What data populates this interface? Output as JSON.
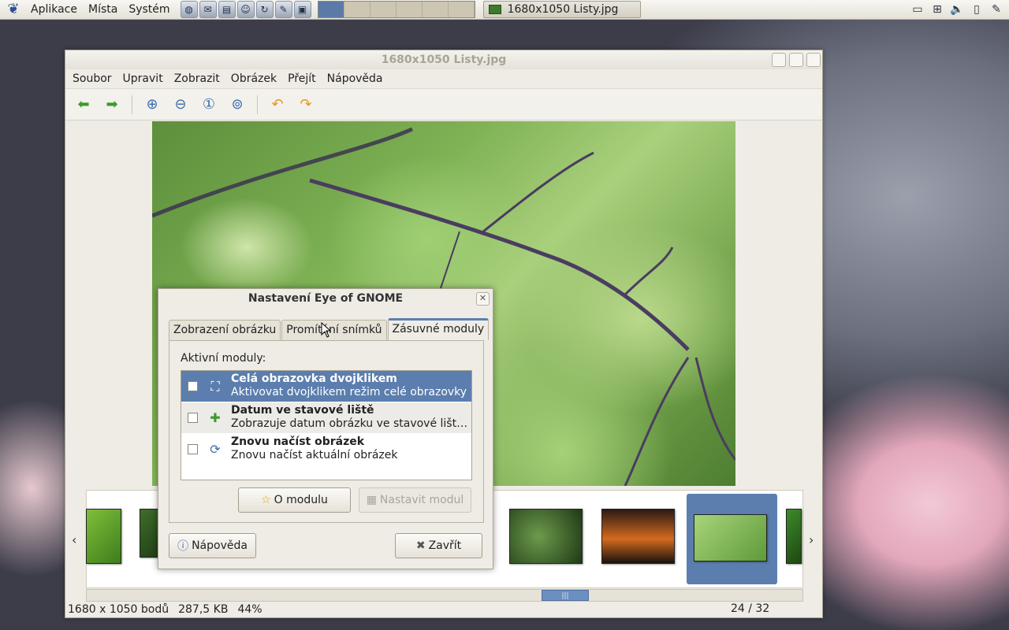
{
  "panel": {
    "menus": [
      "Aplikace",
      "Místa",
      "Systém"
    ],
    "taskbar_title": "1680x1050 Listy.jpg"
  },
  "window": {
    "title": "1680x1050 Listy.jpg",
    "menubar": [
      "Soubor",
      "Upravit",
      "Zobrazit",
      "Obrázek",
      "Přejít",
      "Nápověda"
    ],
    "status": {
      "dimensions": "1680 x 1050 bodů",
      "size": "287,5 KB",
      "zoom": "44%",
      "position": "24 / 32"
    }
  },
  "dialog": {
    "title": "Nastavení Eye of GNOME",
    "tabs": [
      "Zobrazení obrázku",
      "Promítání snímků",
      "Zásuvné moduly"
    ],
    "active_label": "Aktivní moduly:",
    "plugins": [
      {
        "name": "Celá obrazovka dvojklikem",
        "desc": "Aktivovat dvojklikem režim celé obrazovky",
        "icon": "fullscreen-icon"
      },
      {
        "name": "Datum ve stavové liště",
        "desc": "Zobrazuje datum obrázku ve stavové liště…",
        "icon": "puzzle-icon"
      },
      {
        "name": "Znovu načíst obrázek",
        "desc": "Znovu načíst aktuální obrázek",
        "icon": "reload-icon"
      }
    ],
    "about_btn": "O modulu",
    "configure_btn": "Nastavit modul",
    "help_btn": "Nápověda",
    "close_btn": "Zavřít"
  },
  "colors": {
    "selection": "#5b7eae",
    "panel": "#e4e1d7"
  }
}
